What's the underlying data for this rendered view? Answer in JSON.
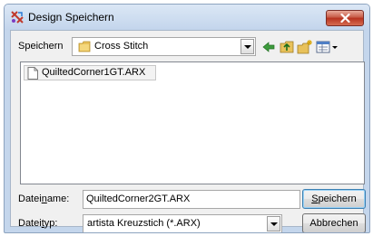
{
  "window": {
    "title": "Design Speichern"
  },
  "toolbar": {
    "save_in_label": "Speichern",
    "folder": "Cross Stitch",
    "icons": [
      "back-arrow-icon",
      "up-folder-icon",
      "new-folder-icon",
      "view-menu-icon"
    ]
  },
  "files": [
    {
      "name": "QuiltedCorner1GT.ARX",
      "icon": "document-icon"
    }
  ],
  "filename": {
    "label_pre": "Datei",
    "label_u": "n",
    "label_post": "ame:",
    "value": "QuiltedCorner2GT.ARX"
  },
  "filetype": {
    "label_pre": "Datei",
    "label_u": "t",
    "label_post": "yp:",
    "value": "artista Kreuzstich (*.ARX)"
  },
  "buttons": {
    "save_u": "S",
    "save_rest": "peichern",
    "cancel": "Abbrechen"
  },
  "colors": {
    "close_button": "#c75a46",
    "title_bar": "#c4d6ec"
  }
}
